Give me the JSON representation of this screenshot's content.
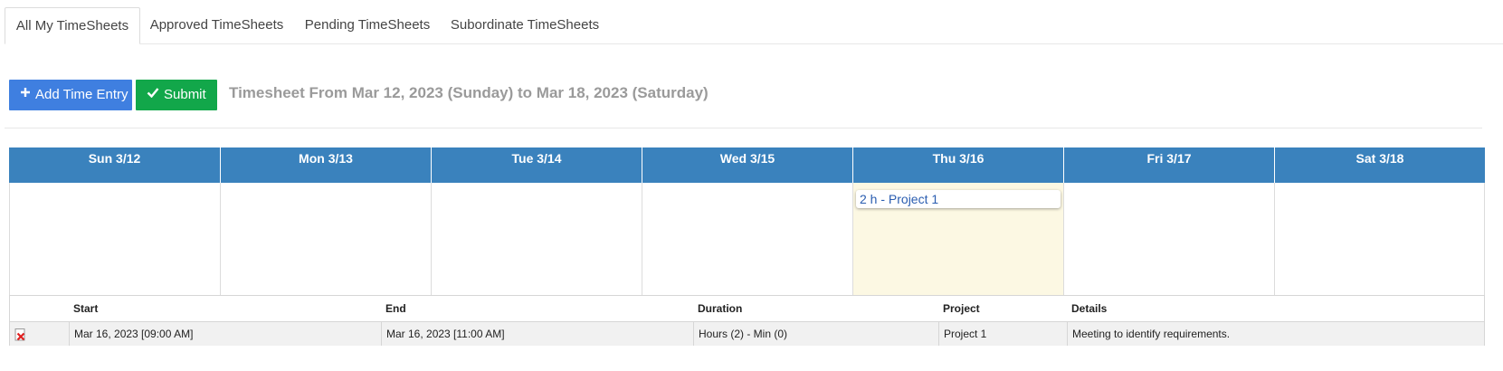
{
  "tabs": [
    {
      "label": "All My TimeSheets",
      "active": true
    },
    {
      "label": "Approved TimeSheets",
      "active": false
    },
    {
      "label": "Pending TimeSheets",
      "active": false
    },
    {
      "label": "Subordinate TimeSheets",
      "active": false
    }
  ],
  "toolbar": {
    "add_label": "Add Time Entry",
    "submit_label": "Submit",
    "title": "Timesheet From Mar 12, 2023 (Sunday) to Mar 18, 2023 (Saturday)",
    "add_icon": "plus-icon",
    "submit_icon": "checkmark-icon"
  },
  "calendar": {
    "header_color": "#3a82bd",
    "today_color": "#fcf8e3",
    "days": [
      {
        "label": "Sun 3/12"
      },
      {
        "label": "Mon 3/13"
      },
      {
        "label": "Tue 3/14"
      },
      {
        "label": "Wed 3/15"
      },
      {
        "label": "Thu 3/16",
        "today": true,
        "event": "2 h - Project 1"
      },
      {
        "label": "Fri 3/17"
      },
      {
        "label": "Sat 3/18"
      }
    ]
  },
  "entries": {
    "columns": [
      "Start",
      "End",
      "Duration",
      "Project",
      "Details"
    ],
    "rows": [
      {
        "delete_icon": "delete-icon",
        "start": "Mar 16, 2023 [09:00 AM]",
        "end": "Mar 16, 2023 [11:00 AM]",
        "duration": "Hours (2) - Min (0)",
        "project": "Project 1",
        "details": "Meeting to identify requirements."
      }
    ]
  }
}
